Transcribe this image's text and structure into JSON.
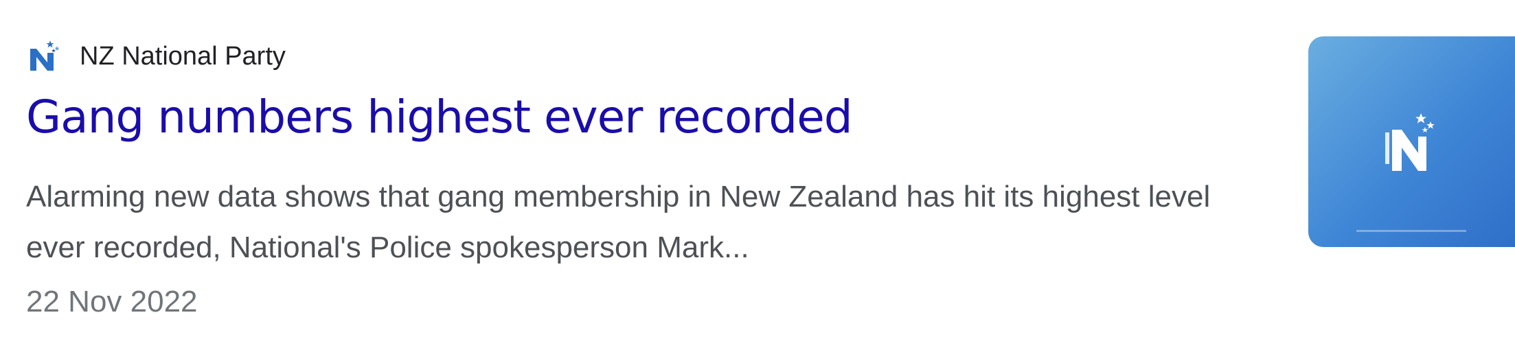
{
  "result": {
    "source": "NZ National Party",
    "title": "Gang numbers highest ever recorded",
    "snippet": "Alarming new data shows that gang membership in New Zealand has hit its highest level ever recorded, National's Police spokesperson Mark...",
    "date": "22 Nov 2022"
  },
  "icons": {
    "favicon": "national-party-logo-icon",
    "thumbnail": "national-party-logo-thumbnail"
  },
  "colors": {
    "title_link": "#1a0dab",
    "snippet_text": "#4d5156",
    "date_text": "#70757a",
    "brand_blue": "#2f6fc8"
  }
}
